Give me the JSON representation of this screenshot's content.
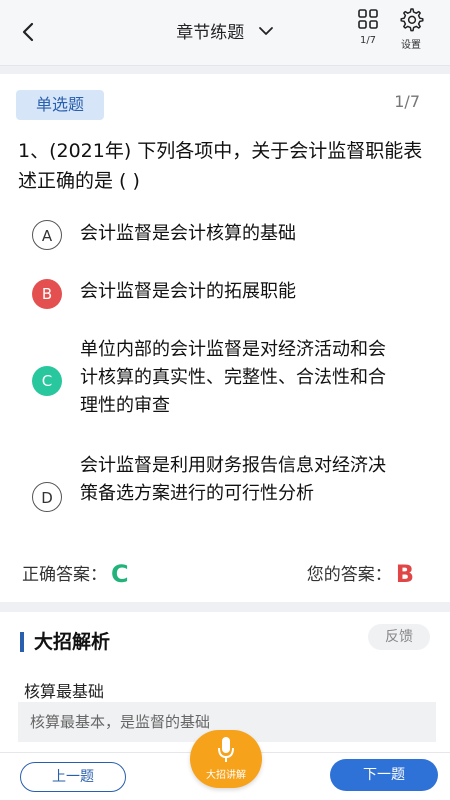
{
  "header": {
    "title": "章节练题",
    "page_indicator": "1/7",
    "settings_label": "设置"
  },
  "question": {
    "type_badge": "单选题",
    "counter": "1/7",
    "text": "1、(2021年) 下列各项中，关于会计监督职能表述正确的是 (    )",
    "options": [
      {
        "letter": "A",
        "text": "会计监督是会计核算的基础",
        "state": "normal"
      },
      {
        "letter": "B",
        "text": "会计监督是会计的拓展职能",
        "state": "wrong"
      },
      {
        "letter": "C",
        "text": "单位内部的会计监督是对经济活动和会计核算的真实性、完整性、合法性和合理性的审查",
        "state": "correct"
      },
      {
        "letter": "D",
        "text": "会计监督是利用财务报告信息对经济决策备选方案进行的可行性分析",
        "state": "normal"
      }
    ],
    "correct_label": "正确答案：",
    "correct_value": "C",
    "your_label": "您的答案：",
    "your_value": "B"
  },
  "analysis": {
    "title": "大招解析",
    "feedback": "反馈",
    "subtitle": "核算最基础",
    "content": "核算最基本，是监督的基础"
  },
  "footer": {
    "prev": "上一题",
    "next": "下一题",
    "mic_label": "大招讲解"
  },
  "colors": {
    "primary": "#2f72d7",
    "correct": "#28c79e",
    "wrong": "#e45050",
    "mic": "#f7a21b"
  }
}
